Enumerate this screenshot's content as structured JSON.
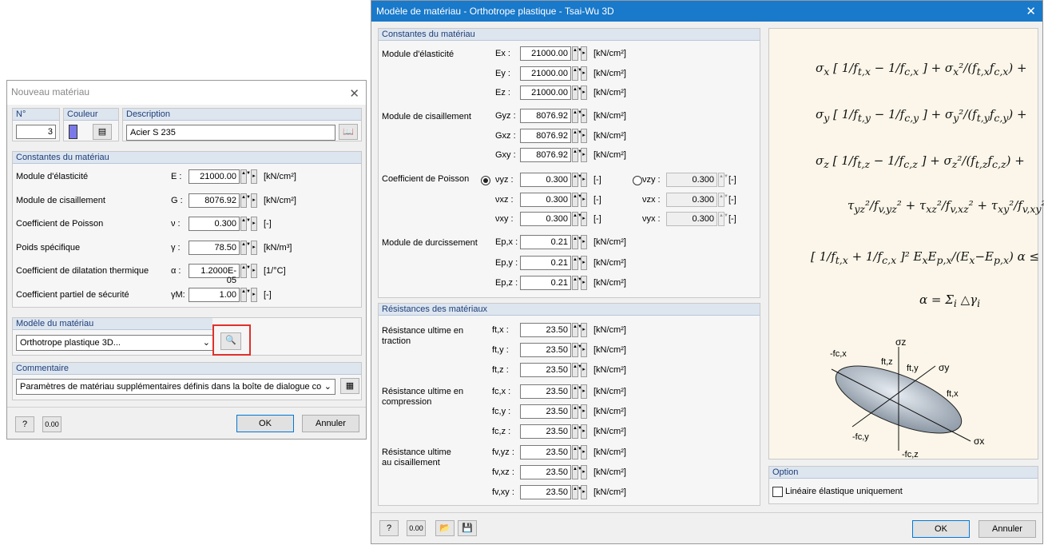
{
  "left": {
    "title": "Nouveau matériau",
    "no_label": "N°",
    "no_value": "3",
    "color_label": "Couleur",
    "desc_label": "Description",
    "desc_value": "Acier S 235",
    "constants_header": "Constantes du matériau",
    "rows": [
      {
        "label": "Module d'élasticité",
        "sym": "E :",
        "value": "21000.00",
        "unit": "[kN/cm²]"
      },
      {
        "label": "Module de cisaillement",
        "sym": "G :",
        "value": "8076.92",
        "unit": "[kN/cm²]"
      },
      {
        "label": "Coefficient de Poisson",
        "sym": "ν :",
        "value": "0.300",
        "unit": "[-]"
      },
      {
        "label": "Poids spécifique",
        "sym": "γ :",
        "value": "78.50",
        "unit": "[kN/m³]"
      },
      {
        "label": "Coefficient de dilatation thermique",
        "sym": "α :",
        "value": "1.2000E-05",
        "unit": "[1/°C]"
      },
      {
        "label": "Coefficient partiel de sécurité",
        "sym": "γM:",
        "value": "1.00",
        "unit": "[-]"
      }
    ],
    "model_header": "Modèle du matériau",
    "model_value": "Orthotrope plastique 3D...",
    "comment_header": "Commentaire",
    "comment_value": "Paramètres de matériau supplémentaires définis dans la boîte de dialogue corr",
    "ok": "OK",
    "cancel": "Annuler",
    "highlight_color": "#e0302c"
  },
  "right": {
    "title": "Modèle de matériau - Orthotrope plastique - Tsai-Wu 3D",
    "constants_header": "Constantes du matériau",
    "elasticity_label": "Module d'élasticité",
    "E": [
      {
        "sym": "Ex :",
        "value": "21000.00",
        "unit": "[kN/cm²]"
      },
      {
        "sym": "Ey :",
        "value": "21000.00",
        "unit": "[kN/cm²]"
      },
      {
        "sym": "Ez :",
        "value": "21000.00",
        "unit": "[kN/cm²]"
      }
    ],
    "shear_label": "Module de cisaillement",
    "G": [
      {
        "sym": "Gyz :",
        "value": "8076.92",
        "unit": "[kN/cm²]"
      },
      {
        "sym": "Gxz :",
        "value": "8076.92",
        "unit": "[kN/cm²]"
      },
      {
        "sym": "Gxy :",
        "value": "8076.92",
        "unit": "[kN/cm²]"
      }
    ],
    "poisson_label": "Coefficient de Poisson",
    "nu_left": [
      {
        "sym": "νyz :",
        "value": "0.300",
        "unit": "[-]"
      },
      {
        "sym": "νxz :",
        "value": "0.300",
        "unit": "[-]"
      },
      {
        "sym": "νxy :",
        "value": "0.300",
        "unit": "[-]"
      }
    ],
    "nu_right": [
      {
        "sym": "νzy :",
        "value": "0.300",
        "unit": "[-]"
      },
      {
        "sym": "νzx :",
        "value": "0.300",
        "unit": "[-]"
      },
      {
        "sym": "νyx :",
        "value": "0.300",
        "unit": "[-]"
      }
    ],
    "hardening_label": "Module de durcissement",
    "Ep": [
      {
        "sym": "Ep,x :",
        "value": "0.21",
        "unit": "[kN/cm²]"
      },
      {
        "sym": "Ep,y :",
        "value": "0.21",
        "unit": "[kN/cm²]"
      },
      {
        "sym": "Ep,z :",
        "value": "0.21",
        "unit": "[kN/cm²]"
      }
    ],
    "resist_header": "Résistances des matériaux",
    "tension_label1": "Résistance ultime en",
    "tension_label2": "traction",
    "ft": [
      {
        "sym": "ft,x :",
        "value": "23.50",
        "unit": "[kN/cm²]"
      },
      {
        "sym": "ft,y :",
        "value": "23.50",
        "unit": "[kN/cm²]"
      },
      {
        "sym": "ft,z :",
        "value": "23.50",
        "unit": "[kN/cm²]"
      }
    ],
    "comp_label1": "Résistance ultime en",
    "comp_label2": "compression",
    "fc": [
      {
        "sym": "fc,x :",
        "value": "23.50",
        "unit": "[kN/cm²]"
      },
      {
        "sym": "fc,y :",
        "value": "23.50",
        "unit": "[kN/cm²]"
      },
      {
        "sym": "fc,z :",
        "value": "23.50",
        "unit": "[kN/cm²]"
      }
    ],
    "shear_res_label1": "Résistance ultime",
    "shear_res_label2": "au cisaillement",
    "fv": [
      {
        "sym": "fv,yz :",
        "value": "23.50",
        "unit": "[kN/cm²]"
      },
      {
        "sym": "fv,xz :",
        "value": "23.50",
        "unit": "[kN/cm²]"
      },
      {
        "sym": "fv,xy :",
        "value": "23.50",
        "unit": "[kN/cm²]"
      }
    ],
    "option_header": "Option",
    "option_label": "Linéaire élastique uniquement",
    "ok": "OK",
    "cancel": "Annuler",
    "diagram_labels": {
      "sz": "σz",
      "sy": "σy",
      "sx": "σx",
      "fcx": "-fc,x",
      "ftz": "ft,z",
      "fty": "ft,y",
      "ftx": "ft,x",
      "fcy": "-fc,y",
      "fcz": "-fc,z"
    }
  }
}
